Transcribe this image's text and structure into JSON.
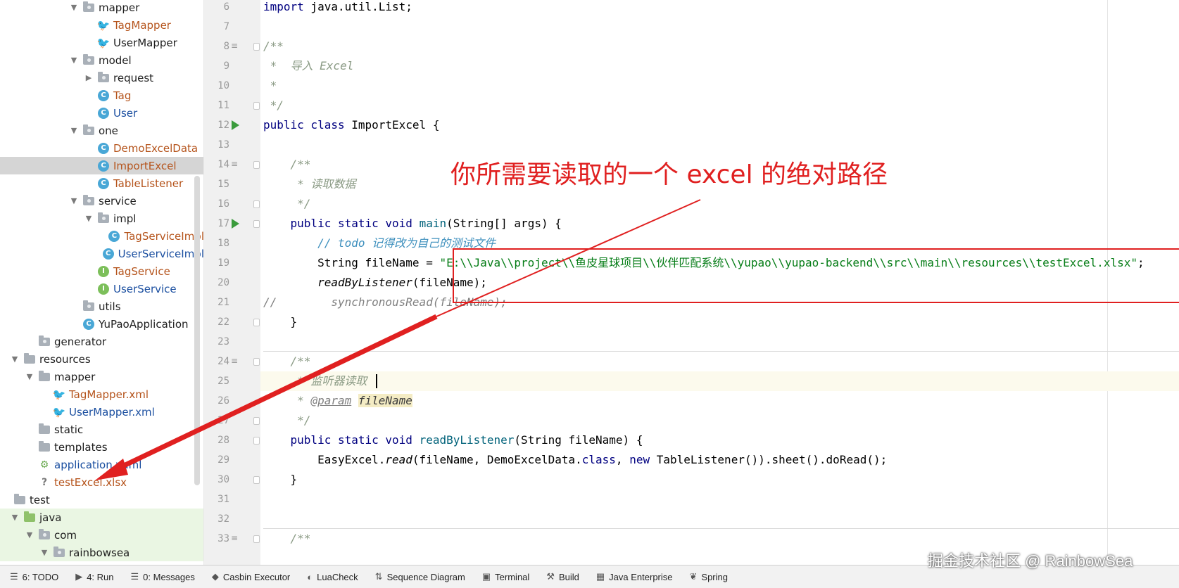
{
  "tree": {
    "items": [
      {
        "label": "mapper",
        "indent": 4,
        "arrow": "▼",
        "icon": "pkg",
        "color": "dark"
      },
      {
        "label": "TagMapper",
        "indent": 5,
        "arrow": "",
        "icon": "mybatis",
        "color": "orange"
      },
      {
        "label": "UserMapper",
        "indent": 5,
        "arrow": "",
        "icon": "mybatis",
        "color": "dark"
      },
      {
        "label": "model",
        "indent": 4,
        "arrow": "▼",
        "icon": "pkg",
        "color": "dark"
      },
      {
        "label": "request",
        "indent": 5,
        "arrow": "▶",
        "icon": "pkg",
        "color": "dark"
      },
      {
        "label": "Tag",
        "indent": 5,
        "arrow": "",
        "icon": "class",
        "color": "orange"
      },
      {
        "label": "User",
        "indent": 5,
        "arrow": "",
        "icon": "class",
        "color": "blue"
      },
      {
        "label": "one",
        "indent": 4,
        "arrow": "▼",
        "icon": "pkg",
        "color": "dark"
      },
      {
        "label": "DemoExcelData",
        "indent": 5,
        "arrow": "",
        "icon": "class",
        "color": "orange"
      },
      {
        "label": "ImportExcel",
        "indent": 5,
        "arrow": "",
        "icon": "class",
        "color": "orange",
        "selected": true
      },
      {
        "label": "TableListener",
        "indent": 5,
        "arrow": "",
        "icon": "class",
        "color": "orange"
      },
      {
        "label": "service",
        "indent": 4,
        "arrow": "▼",
        "icon": "pkg",
        "color": "dark"
      },
      {
        "label": "impl",
        "indent": 5,
        "arrow": "▼",
        "icon": "pkg",
        "color": "dark"
      },
      {
        "label": "TagServiceImpl",
        "indent": 6,
        "arrow": "",
        "icon": "class",
        "color": "orange"
      },
      {
        "label": "UserServiceImpl",
        "indent": 6,
        "arrow": "",
        "icon": "class",
        "color": "blue"
      },
      {
        "label": "TagService",
        "indent": 5,
        "arrow": "",
        "icon": "iface",
        "color": "orange"
      },
      {
        "label": "UserService",
        "indent": 5,
        "arrow": "",
        "icon": "iface",
        "color": "blue"
      },
      {
        "label": "utils",
        "indent": 4,
        "arrow": "",
        "icon": "pkg",
        "color": "dark"
      },
      {
        "label": "YuPaoApplication",
        "indent": 4,
        "arrow": "",
        "icon": "class",
        "color": "dark"
      },
      {
        "label": "generator",
        "indent": 1,
        "arrow": "",
        "icon": "pkg",
        "color": "dark"
      },
      {
        "label": "resources",
        "indent": 0,
        "arrow": "▼",
        "icon": "res",
        "color": "dark"
      },
      {
        "label": "mapper",
        "indent": 1,
        "arrow": "▼",
        "icon": "folder",
        "color": "dark"
      },
      {
        "label": "TagMapper.xml",
        "indent": 2,
        "arrow": "",
        "icon": "mybatis",
        "color": "orange"
      },
      {
        "label": "UserMapper.xml",
        "indent": 2,
        "arrow": "",
        "icon": "mybatis",
        "color": "blue"
      },
      {
        "label": "static",
        "indent": 1,
        "arrow": "",
        "icon": "folder",
        "color": "dark"
      },
      {
        "label": "templates",
        "indent": 1,
        "arrow": "",
        "icon": "folder",
        "color": "dark"
      },
      {
        "label": "application.yaml",
        "indent": 1,
        "arrow": "",
        "icon": "yaml",
        "color": "blue"
      },
      {
        "label": "testExcel.xlsx",
        "indent": 1,
        "arrow": "",
        "icon": "xlsx",
        "color": "orange"
      },
      {
        "label": "test",
        "indent": -1,
        "arrow": "",
        "icon": "folder",
        "color": "dark"
      },
      {
        "label": "java",
        "indent": 0,
        "arrow": "▼",
        "icon": "green",
        "color": "dark",
        "test": true
      },
      {
        "label": "com",
        "indent": 1,
        "arrow": "▼",
        "icon": "pkg",
        "color": "dark",
        "test": true
      },
      {
        "label": "rainbowsea",
        "indent": 2,
        "arrow": "▼",
        "icon": "pkg",
        "color": "dark",
        "test": true
      }
    ]
  },
  "editor": {
    "lines": [
      {
        "n": "6",
        "html": "<span class=\"kw\">import</span> java.util.List;"
      },
      {
        "n": "7",
        "html": ""
      },
      {
        "n": "8",
        "html": "<span class=\"doc\">/**</span>"
      },
      {
        "n": "9",
        "html": "<span class=\"doc\"> *  导入 Excel</span>"
      },
      {
        "n": "10",
        "html": "<span class=\"doc\"> *</span>"
      },
      {
        "n": "11",
        "html": "<span class=\"doc\"> */</span>"
      },
      {
        "n": "12",
        "html": "<span class=\"kw\">public class</span> ImportExcel {"
      },
      {
        "n": "13",
        "html": ""
      },
      {
        "n": "14",
        "html": "    <span class=\"doc\">/**</span>"
      },
      {
        "n": "15",
        "html": "<span class=\"doc\">     * 读取数据</span>"
      },
      {
        "n": "16",
        "html": "<span class=\"doc\">     */</span>"
      },
      {
        "n": "17",
        "html": "    <span class=\"kw\">public static void</span> <span class=\"fn\">main</span>(String[] args) {"
      },
      {
        "n": "18",
        "html": "        <span class=\"todo\">// todo 记得改为自己的测试文件</span>"
      },
      {
        "n": "19",
        "html": "        String fileName = <span class=\"str\">\"E:\\\\Java\\\\project\\\\鱼皮星球项目\\\\伙伴匹配系统\\\\yupao\\\\yupao-backend\\\\src\\\\main\\\\resources\\\\testExcel.xlsx\"</span>;"
      },
      {
        "n": "20",
        "html": "        <span class=\"it\">readByListener</span>(fileName);"
      },
      {
        "n": "21",
        "html": "<span class=\"cmt\">//        synchronousRead(fileName);</span>"
      },
      {
        "n": "22",
        "html": "    }"
      },
      {
        "n": "23",
        "html": ""
      },
      {
        "n": "24",
        "html": "    <span class=\"doc\">/**</span>"
      },
      {
        "n": "25",
        "html": "<span class=\"doc\">     * 监听器读取</span>"
      },
      {
        "n": "26",
        "html": "<span class=\"doc\">     * </span><span class=\"tag\">@param</span> <span class=\"param-hl\">fileName</span>"
      },
      {
        "n": "27",
        "html": "<span class=\"doc\">     */</span>"
      },
      {
        "n": "28",
        "html": "    <span class=\"kw\">public static void</span> <span class=\"fn\">readByListener</span>(String fileName) {"
      },
      {
        "n": "29",
        "html": "        EasyExcel.<span class=\"it\">read</span>(fileName, DemoExcelData.<span class=\"kw\">class</span>, <span class=\"kw\">new</span> TableListener()).sheet().doRead();"
      },
      {
        "n": "30",
        "html": "    }"
      },
      {
        "n": "31",
        "html": ""
      },
      {
        "n": "32",
        "html": ""
      },
      {
        "n": "33",
        "html": "    <span class=\"doc\">/**</span>"
      }
    ]
  },
  "annotation": {
    "text": "你所需要读取的一个 excel 的绝对路径",
    "color": "#e02020"
  },
  "toolbar": {
    "items": [
      {
        "icon": "☰",
        "label": "6: TODO"
      },
      {
        "icon": "▶",
        "label": "4: Run"
      },
      {
        "icon": "☰",
        "label": "0: Messages"
      },
      {
        "icon": "◆",
        "label": "Casbin Executor"
      },
      {
        "icon": "◐",
        "label": "LuaCheck"
      },
      {
        "icon": "⇅",
        "label": "Sequence Diagram"
      },
      {
        "icon": "▣",
        "label": "Terminal"
      },
      {
        "icon": "⚒",
        "label": "Build"
      },
      {
        "icon": "▦",
        "label": "Java Enterprise"
      },
      {
        "icon": "❦",
        "label": "Spring"
      }
    ]
  },
  "watermark": "掘金技术社区 @ RainbowSea"
}
